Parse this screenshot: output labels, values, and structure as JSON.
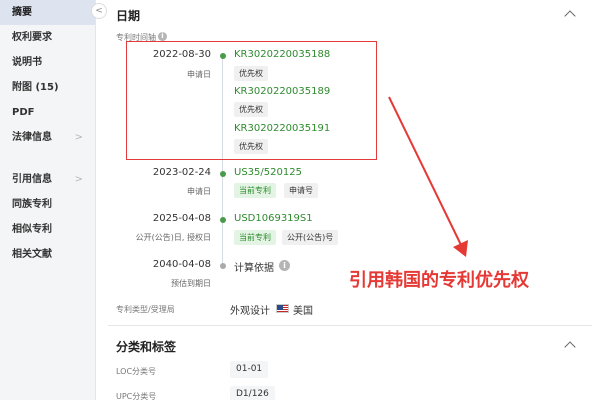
{
  "sidebar": {
    "items": [
      {
        "label": "摘要",
        "active": true
      },
      {
        "label": "权利要求"
      },
      {
        "label": "说明书"
      },
      {
        "label": "附图 (15)"
      },
      {
        "label": "PDF"
      },
      {
        "label": "法律信息",
        "chevron": true
      }
    ],
    "items2": [
      {
        "label": "引用信息",
        "chevron": true
      },
      {
        "label": "同族专利"
      },
      {
        "label": "相似专利"
      },
      {
        "label": "相关文献"
      }
    ],
    "collapse_icon": "chevron-left-icon"
  },
  "dates_section": {
    "title": "日期",
    "timeline_label": "专利时间轴",
    "events": [
      {
        "date": "2022-08-30",
        "sub": "申请日"
      },
      {
        "date": "2023-02-24",
        "sub": "申请日"
      },
      {
        "date": "2025-04-08",
        "sub": "公开(公告)日, 授权日"
      },
      {
        "date": "2040-04-08",
        "sub": "预估到期日"
      }
    ],
    "patents": [
      {
        "number": "KR3020220035188",
        "tags": [
          "优先权"
        ]
      },
      {
        "number": "KR3020220035189",
        "tags": [
          "优先权"
        ]
      },
      {
        "number": "KR3020220035191",
        "tags": [
          "优先权"
        ]
      },
      {
        "number": "US35/520125",
        "tags": [
          "当前专利",
          "申请号"
        ]
      },
      {
        "number": "USD1069319S1",
        "tags": [
          "当前专利",
          "公开(公告)号"
        ]
      },
      {
        "number": "计算依据"
      }
    ],
    "type_label": "专利类型/受理局",
    "type_value": "外观设计",
    "country": "美国"
  },
  "annotation": "引用韩国的专利优先权",
  "classification": {
    "title": "分类和标签",
    "rows": [
      {
        "label": "LOC分类号",
        "value": "01-01"
      },
      {
        "label": "UPC分类号",
        "value": "D1/126"
      }
    ]
  },
  "colors": {
    "accent_green": "#2e8b2e",
    "annotation_red": "#e53935"
  }
}
